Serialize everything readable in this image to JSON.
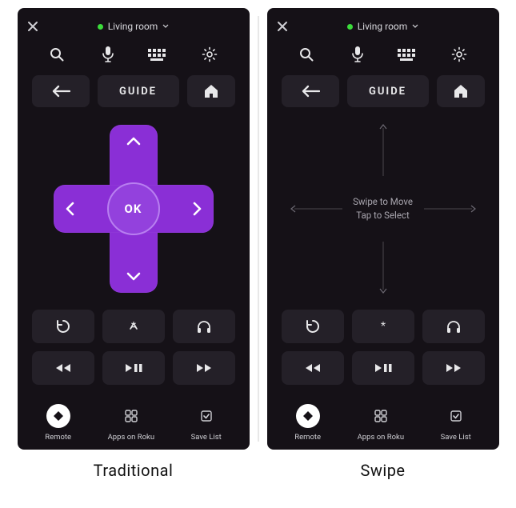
{
  "top": {
    "device_name": "Living room"
  },
  "nav": {
    "guide_label": "GUIDE"
  },
  "dpad": {
    "ok_label": "OK"
  },
  "swipe": {
    "hint_line1": "Swipe to Move",
    "hint_line2": "Tap to Select"
  },
  "bottom_nav": {
    "remote": "Remote",
    "apps": "Apps on Roku",
    "save": "Save List"
  },
  "captions": {
    "left": "Traditional",
    "right": "Swipe"
  },
  "colors": {
    "accent": "#8a2fd6",
    "panel_bg": "#151117",
    "button_bg": "#242028",
    "online_dot": "#3bdc3b"
  }
}
